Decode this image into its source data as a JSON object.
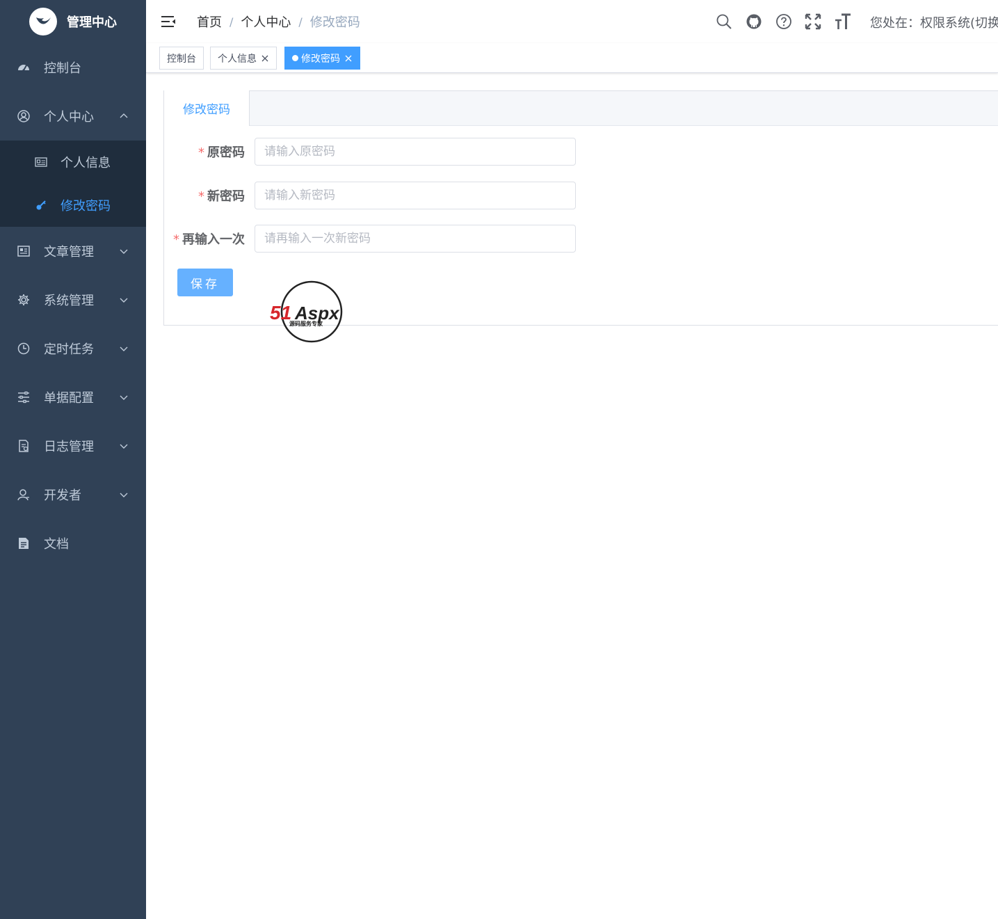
{
  "brand": {
    "title": "管理中心"
  },
  "sidebar": {
    "items": [
      {
        "label": "控制台",
        "icon": "dashboard-icon"
      },
      {
        "label": "个人中心",
        "icon": "user-circle-icon",
        "expanded": true,
        "children": [
          {
            "label": "个人信息",
            "icon": "id-card-icon"
          },
          {
            "label": "修改密码",
            "icon": "key-icon",
            "active": true
          }
        ]
      },
      {
        "label": "文章管理",
        "icon": "article-icon"
      },
      {
        "label": "系统管理",
        "icon": "gear-icon"
      },
      {
        "label": "定时任务",
        "icon": "clock-icon"
      },
      {
        "label": "单据配置",
        "icon": "sliders-icon"
      },
      {
        "label": "日志管理",
        "icon": "log-icon"
      },
      {
        "label": "开发者",
        "icon": "developer-icon"
      },
      {
        "label": "文档",
        "icon": "document-icon"
      }
    ]
  },
  "header": {
    "breadcrumb": [
      "首页",
      "个人中心",
      "修改密码"
    ],
    "separator": "/",
    "location_text": "您处在：权限系统(切换"
  },
  "tags": [
    {
      "label": "控制台"
    },
    {
      "label": "个人信息"
    },
    {
      "label": "修改密码",
      "active": true
    }
  ],
  "form": {
    "tab_label": "修改密码",
    "required_mark": "*",
    "fields": [
      {
        "label": "原密码",
        "placeholder": "请输入原密码",
        "value": ""
      },
      {
        "label": "新密码",
        "placeholder": "请输入新密码",
        "value": ""
      },
      {
        "label": "再输入一次",
        "placeholder": "请再输入一次新密码",
        "value": ""
      }
    ],
    "save_label": "保存"
  },
  "watermark": {
    "brand": "51Aspx",
    "tagline": "源码服务专家"
  },
  "colors": {
    "sidebar_bg": "#304156",
    "submenu_bg": "#1f2d3d",
    "accent": "#409eff",
    "button": "#66b1ff",
    "required": "#f56c6c"
  }
}
